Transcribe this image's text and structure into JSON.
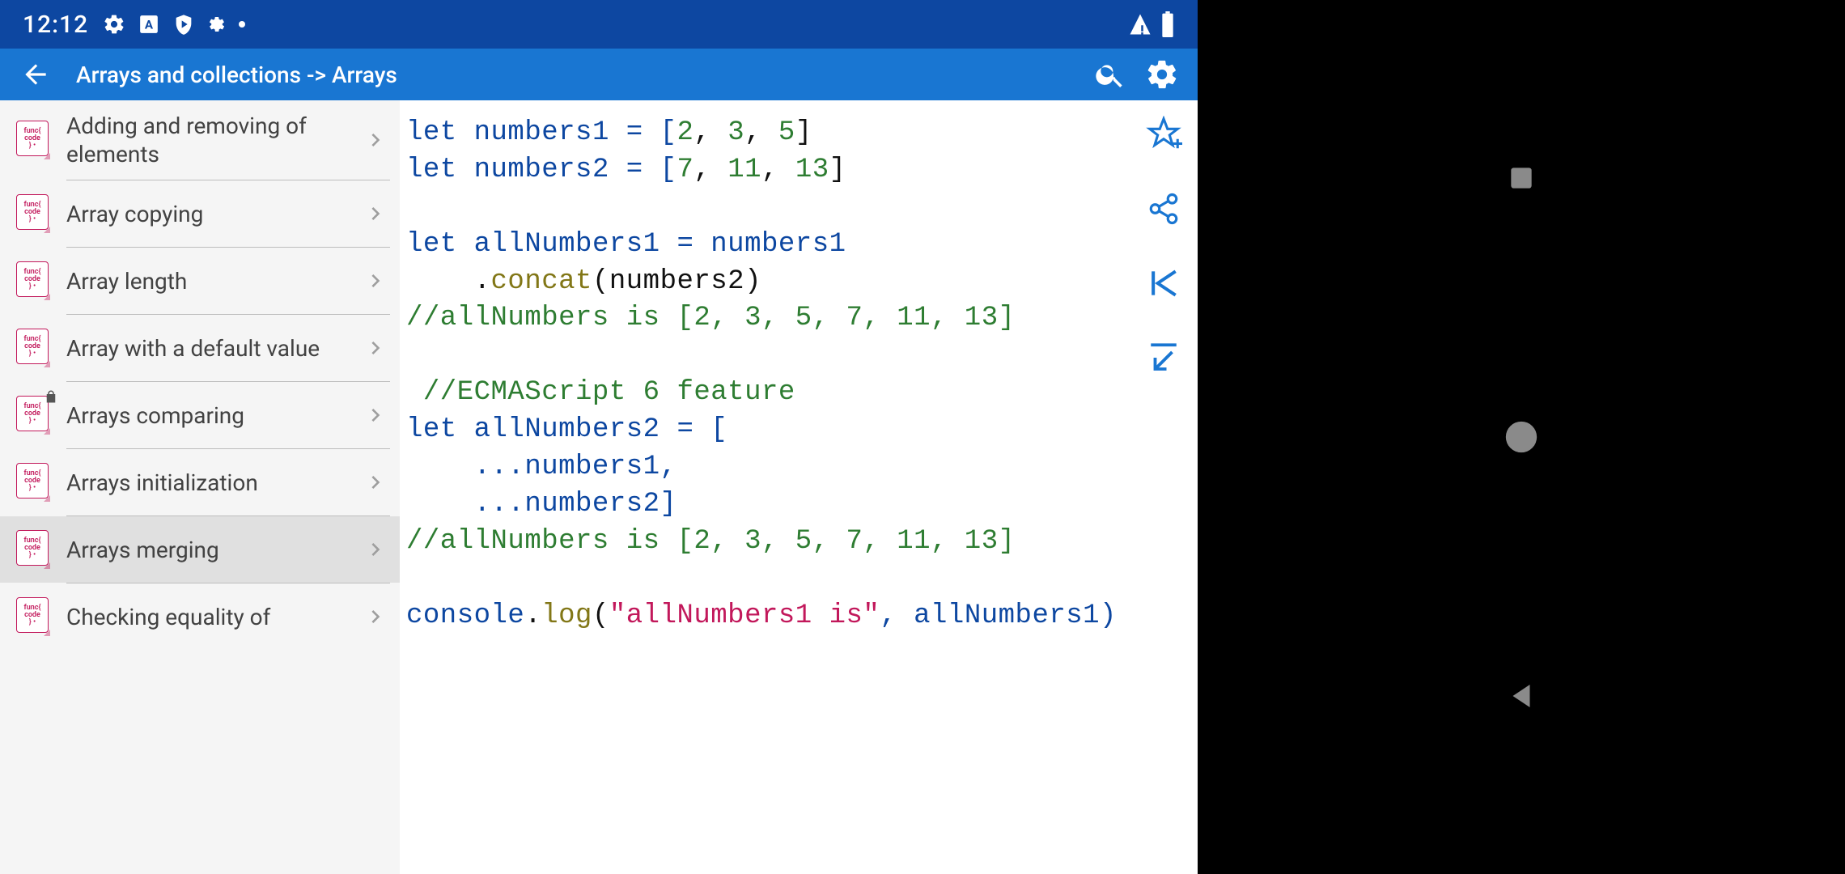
{
  "status_bar": {
    "time": "12:12"
  },
  "app_bar": {
    "title": "Arrays and collections -> Arrays"
  },
  "sidebar": {
    "items": [
      {
        "label": "Adding and removing of elements",
        "locked": false
      },
      {
        "label": "Array copying",
        "locked": false
      },
      {
        "label": "Array length",
        "locked": false
      },
      {
        "label": "Array with a default value",
        "locked": false
      },
      {
        "label": "Arrays comparing",
        "locked": true
      },
      {
        "label": "Arrays initialization",
        "locked": false
      },
      {
        "label": "Arrays merging",
        "locked": false,
        "selected": true
      },
      {
        "label": "Checking equality of",
        "locked": false
      }
    ]
  },
  "code": {
    "l1a": "let",
    "l1b": " numbers1 = [",
    "l1c": "2",
    "l1d": ", ",
    "l1e": "3",
    "l1f": ", ",
    "l1g": "5",
    "l1h": "]",
    "l2a": "let",
    "l2b": " numbers2 = [",
    "l2c": "7",
    "l2d": ", ",
    "l2e": "11",
    "l2f": ", ",
    "l2g": "13",
    "l2h": "]",
    "l4a": "let",
    "l4b": " allNumbers1 = numbers1",
    "l5a": "    .",
    "l5b": "concat",
    "l5c": "(numbers2)",
    "l6": "//allNumbers is [2, 3, 5, 7, 11, 13]",
    "l8": " //ECMAScript 6 feature",
    "l9a": "let",
    "l9b": " allNumbers2 = [",
    "l10": "    ...numbers1,",
    "l11": "    ...numbers2]",
    "l12": "//allNumbers is [2, 3, 5, 7, 11, 13]",
    "l14a": "console",
    "l14b": ".",
    "l14c": "log",
    "l14d": "(",
    "l14e": "\"allNumbers1 is\"",
    "l14f": ", allNumbers1)"
  }
}
